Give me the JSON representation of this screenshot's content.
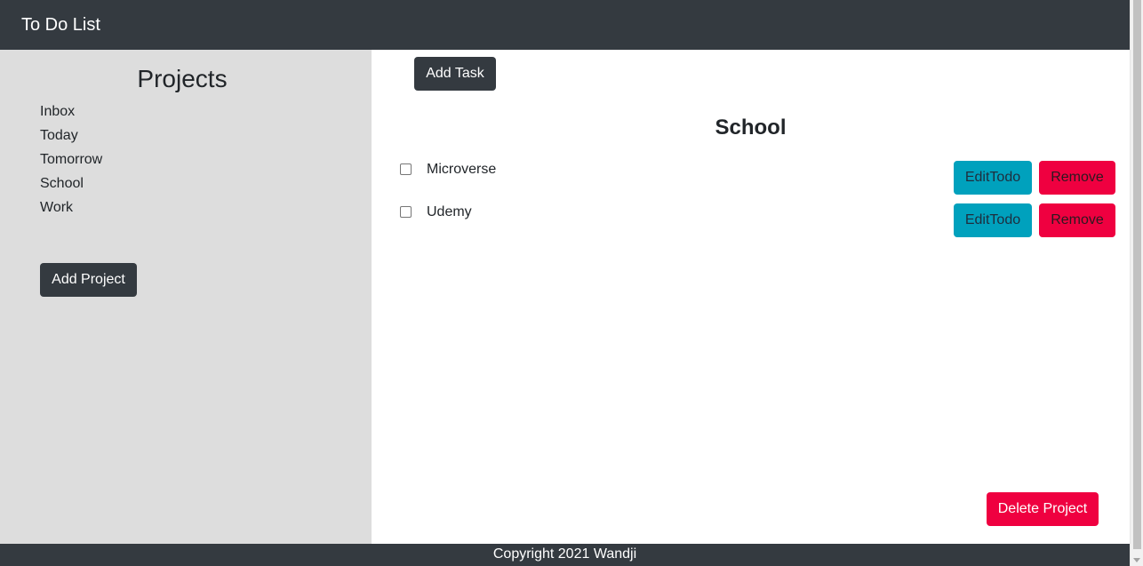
{
  "navbar": {
    "brand": "To Do List"
  },
  "sidebar": {
    "title": "Projects",
    "projects": [
      "Inbox",
      "Today",
      "Tomorrow",
      "School",
      "Work"
    ],
    "add_project_label": "Add Project"
  },
  "main": {
    "add_task_label": "Add Task",
    "project_title": "School",
    "todos": [
      {
        "title": "Microverse",
        "checked": false,
        "edit_label": "EditTodo",
        "remove_label": "Remove"
      },
      {
        "title": "Udemy",
        "checked": false,
        "edit_label": "EditTodo",
        "remove_label": "Remove"
      }
    ],
    "delete_project_label": "Delete Project"
  },
  "footer": {
    "text": "Copyright 2021 Wandji"
  },
  "colors": {
    "navbar": "#343a40",
    "sidebar": "#dddddd",
    "info": "#00a1bd",
    "danger": "#ef0040"
  }
}
